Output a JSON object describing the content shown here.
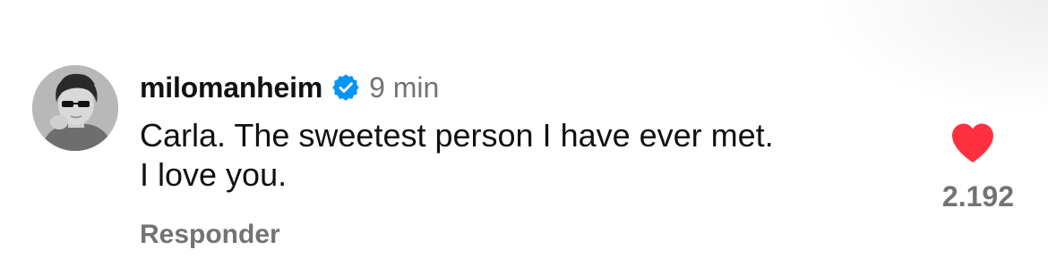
{
  "comment": {
    "username": "milomanheim",
    "verified": true,
    "time": "9 min",
    "text": "Carla. The sweetest person I have ever met.\nI love you.",
    "reply_label": "Responder",
    "likes": "2.192",
    "liked": true
  },
  "colors": {
    "heart": "#ff3040",
    "verified_badge": "#0095f6",
    "secondary_text": "#737373",
    "primary_text": "#111111"
  },
  "icons": {
    "verified": "verified-badge-icon",
    "like": "heart-filled-icon"
  }
}
